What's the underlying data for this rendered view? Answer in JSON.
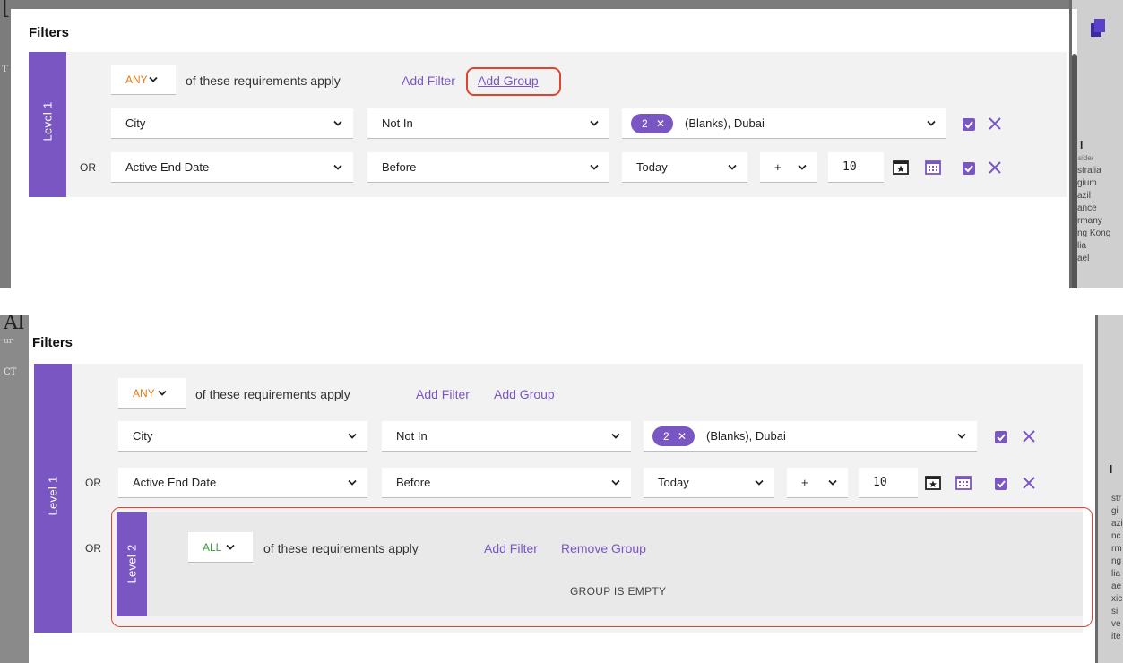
{
  "colors": {
    "accent": "#7a56c2",
    "any_color": "#e07b1a",
    "all_color": "#3a9a3a",
    "highlight": "#e0432e"
  },
  "background": {
    "frag_top": "[",
    "frag_top_left": "T",
    "frag_bottom": "Al",
    "frag_bottom_left": "CT",
    "frag_bottom_left_small": "ur",
    "side_heading": "l",
    "side_sub": "side/",
    "side_items_top": [
      "stralia",
      "gium",
      "azil",
      "ance",
      "rmany",
      "ng Kong",
      "lia",
      "ael"
    ],
    "side_items_bottom": [
      "str",
      "gi",
      "azi",
      "nc",
      "rm",
      "ng",
      "lia",
      "ae",
      "xic",
      "si",
      "ve",
      "ite"
    ]
  },
  "panel_top": {
    "title": "Filters",
    "level_label": "Level 1",
    "any_label": "ANY",
    "requirements_text": "of these requirements apply",
    "add_filter": "Add Filter",
    "add_group": "Add Group",
    "row1": {
      "field": "City",
      "operator": "Not In",
      "chip_count": "2",
      "value_text": "(Blanks), Dubai"
    },
    "row2": {
      "or_label": "OR",
      "field": "Active End Date",
      "operator": "Before",
      "date_value": "Today",
      "sign": "+",
      "number": "10"
    }
  },
  "panel_bottom": {
    "title": "Filters",
    "level_label": "Level 1",
    "any_label": "ANY",
    "requirements_text": "of these requirements apply",
    "add_filter": "Add Filter",
    "add_group": "Add Group",
    "row1": {
      "field": "City",
      "operator": "Not In",
      "chip_count": "2",
      "value_text": "(Blanks), Dubai"
    },
    "row2": {
      "or_label": "OR",
      "field": "Active End Date",
      "operator": "Before",
      "date_value": "Today",
      "sign": "+",
      "number": "10"
    },
    "group2": {
      "or_label": "OR",
      "level_label": "Level 2",
      "all_label": "ALL",
      "requirements_text": "of these requirements apply",
      "add_filter": "Add Filter",
      "remove_group": "Remove Group",
      "empty_text": "GROUP IS EMPTY"
    }
  }
}
